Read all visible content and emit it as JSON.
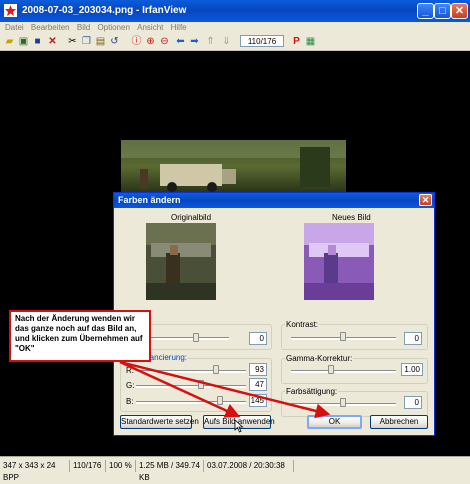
{
  "window": {
    "title": "2008-07-03_203034.png - IrfanView",
    "minimize": "_",
    "maximize": "□",
    "close": "✕"
  },
  "menu": [
    "Datei",
    "Bearbeiten",
    "Bild",
    "Optionen",
    "Ansicht",
    "Hilfe"
  ],
  "toolbar": {
    "page_indicator": "110/176",
    "icons": [
      "open-icon",
      "slideshow-icon",
      "save-icon",
      "delete-icon",
      "cut-icon",
      "copy-icon",
      "paste-icon",
      "undo-icon",
      "info-icon",
      "zoom-in-icon",
      "zoom-out-icon",
      "previous-icon",
      "next-icon",
      "first-icon",
      "last-icon",
      "print-icon",
      "paint-icon"
    ]
  },
  "dialog": {
    "title": "Farben ändern",
    "original_caption": "Originalbild",
    "new_caption": "Neues Bild",
    "left_group_top_value": "0",
    "balance_label": "...ancierung:",
    "r_label": "R:",
    "g_label": "G:",
    "b_label": "B:",
    "r_value": "93",
    "g_value": "47",
    "b_value": "145",
    "contrast_label": "Kontrast:",
    "contrast_value": "0",
    "gamma_label": "Gamma-Korrektur:",
    "gamma_value": "1.00",
    "saturation_label": "Farbsättigung:",
    "saturation_value": "0",
    "btn_defaults": "Standardwerte setzen",
    "btn_apply": "Aufs Bild anwenden",
    "btn_ok": "OK",
    "btn_cancel": "Abbrechen"
  },
  "annotation": {
    "text": "Nach der Änderung wenden wir das ganze noch auf das Bild an, und klicken zum Übernehmen auf \"OK\"",
    "color": "#d41010"
  },
  "status": {
    "dimensions": "347 x 343 x 24 BPP",
    "index": "110/176",
    "zoom": "100 %",
    "size": "1.25 MB / 349.74 KB",
    "datetime": "03.07.2008 / 20:30:38"
  }
}
